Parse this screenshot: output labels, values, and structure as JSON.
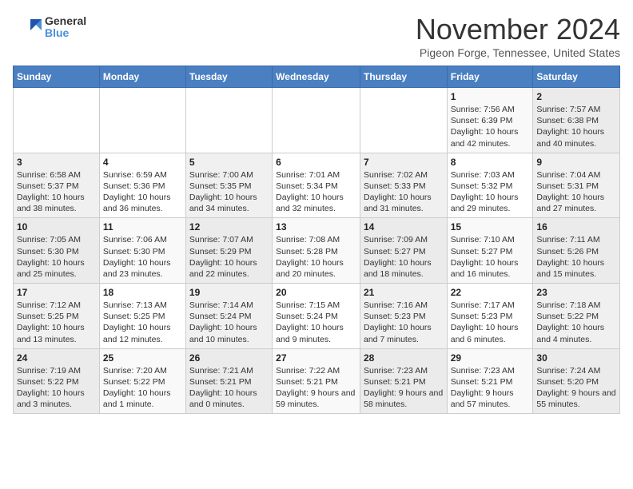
{
  "logo": {
    "general": "General",
    "blue": "Blue"
  },
  "title": "November 2024",
  "location": "Pigeon Forge, Tennessee, United States",
  "days_header": [
    "Sunday",
    "Monday",
    "Tuesday",
    "Wednesday",
    "Thursday",
    "Friday",
    "Saturday"
  ],
  "weeks": [
    [
      {
        "day": "",
        "info": ""
      },
      {
        "day": "",
        "info": ""
      },
      {
        "day": "",
        "info": ""
      },
      {
        "day": "",
        "info": ""
      },
      {
        "day": "",
        "info": ""
      },
      {
        "day": "1",
        "info": "Sunrise: 7:56 AM\nSunset: 6:39 PM\nDaylight: 10 hours and 42 minutes."
      },
      {
        "day": "2",
        "info": "Sunrise: 7:57 AM\nSunset: 6:38 PM\nDaylight: 10 hours and 40 minutes."
      }
    ],
    [
      {
        "day": "3",
        "info": "Sunrise: 6:58 AM\nSunset: 5:37 PM\nDaylight: 10 hours and 38 minutes."
      },
      {
        "day": "4",
        "info": "Sunrise: 6:59 AM\nSunset: 5:36 PM\nDaylight: 10 hours and 36 minutes."
      },
      {
        "day": "5",
        "info": "Sunrise: 7:00 AM\nSunset: 5:35 PM\nDaylight: 10 hours and 34 minutes."
      },
      {
        "day": "6",
        "info": "Sunrise: 7:01 AM\nSunset: 5:34 PM\nDaylight: 10 hours and 32 minutes."
      },
      {
        "day": "7",
        "info": "Sunrise: 7:02 AM\nSunset: 5:33 PM\nDaylight: 10 hours and 31 minutes."
      },
      {
        "day": "8",
        "info": "Sunrise: 7:03 AM\nSunset: 5:32 PM\nDaylight: 10 hours and 29 minutes."
      },
      {
        "day": "9",
        "info": "Sunrise: 7:04 AM\nSunset: 5:31 PM\nDaylight: 10 hours and 27 minutes."
      }
    ],
    [
      {
        "day": "10",
        "info": "Sunrise: 7:05 AM\nSunset: 5:30 PM\nDaylight: 10 hours and 25 minutes."
      },
      {
        "day": "11",
        "info": "Sunrise: 7:06 AM\nSunset: 5:30 PM\nDaylight: 10 hours and 23 minutes."
      },
      {
        "day": "12",
        "info": "Sunrise: 7:07 AM\nSunset: 5:29 PM\nDaylight: 10 hours and 22 minutes."
      },
      {
        "day": "13",
        "info": "Sunrise: 7:08 AM\nSunset: 5:28 PM\nDaylight: 10 hours and 20 minutes."
      },
      {
        "day": "14",
        "info": "Sunrise: 7:09 AM\nSunset: 5:27 PM\nDaylight: 10 hours and 18 minutes."
      },
      {
        "day": "15",
        "info": "Sunrise: 7:10 AM\nSunset: 5:27 PM\nDaylight: 10 hours and 16 minutes."
      },
      {
        "day": "16",
        "info": "Sunrise: 7:11 AM\nSunset: 5:26 PM\nDaylight: 10 hours and 15 minutes."
      }
    ],
    [
      {
        "day": "17",
        "info": "Sunrise: 7:12 AM\nSunset: 5:25 PM\nDaylight: 10 hours and 13 minutes."
      },
      {
        "day": "18",
        "info": "Sunrise: 7:13 AM\nSunset: 5:25 PM\nDaylight: 10 hours and 12 minutes."
      },
      {
        "day": "19",
        "info": "Sunrise: 7:14 AM\nSunset: 5:24 PM\nDaylight: 10 hours and 10 minutes."
      },
      {
        "day": "20",
        "info": "Sunrise: 7:15 AM\nSunset: 5:24 PM\nDaylight: 10 hours and 9 minutes."
      },
      {
        "day": "21",
        "info": "Sunrise: 7:16 AM\nSunset: 5:23 PM\nDaylight: 10 hours and 7 minutes."
      },
      {
        "day": "22",
        "info": "Sunrise: 7:17 AM\nSunset: 5:23 PM\nDaylight: 10 hours and 6 minutes."
      },
      {
        "day": "23",
        "info": "Sunrise: 7:18 AM\nSunset: 5:22 PM\nDaylight: 10 hours and 4 minutes."
      }
    ],
    [
      {
        "day": "24",
        "info": "Sunrise: 7:19 AM\nSunset: 5:22 PM\nDaylight: 10 hours and 3 minutes."
      },
      {
        "day": "25",
        "info": "Sunrise: 7:20 AM\nSunset: 5:22 PM\nDaylight: 10 hours and 1 minute."
      },
      {
        "day": "26",
        "info": "Sunrise: 7:21 AM\nSunset: 5:21 PM\nDaylight: 10 hours and 0 minutes."
      },
      {
        "day": "27",
        "info": "Sunrise: 7:22 AM\nSunset: 5:21 PM\nDaylight: 9 hours and 59 minutes."
      },
      {
        "day": "28",
        "info": "Sunrise: 7:23 AM\nSunset: 5:21 PM\nDaylight: 9 hours and 58 minutes."
      },
      {
        "day": "29",
        "info": "Sunrise: 7:23 AM\nSunset: 5:21 PM\nDaylight: 9 hours and 57 minutes."
      },
      {
        "day": "30",
        "info": "Sunrise: 7:24 AM\nSunset: 5:20 PM\nDaylight: 9 hours and 55 minutes."
      }
    ]
  ]
}
